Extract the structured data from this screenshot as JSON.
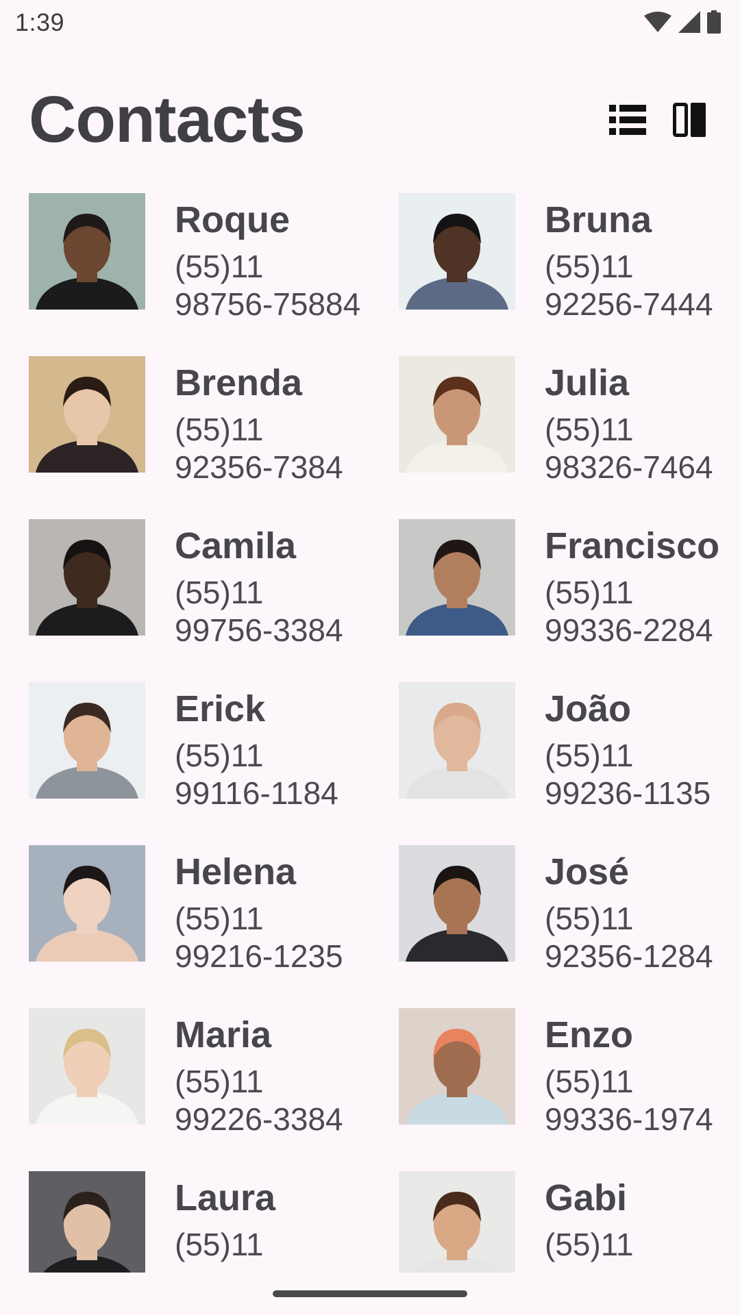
{
  "status": {
    "time": "1:39"
  },
  "header": {
    "title": "Contacts"
  },
  "icons": {
    "list_view": "list-view-icon",
    "grid_view": "two-column-view-icon"
  },
  "contacts": [
    {
      "name": "Roque",
      "phone_prefix": "(55)11",
      "phone_number": "98756-75884",
      "bg": "#9fb3ad",
      "skin": "#6b4630",
      "hair": "#1f1a17",
      "shirt": "#1b1b1d"
    },
    {
      "name": "Bruna",
      "phone_prefix": "(55)11",
      "phone_number": "92256-7444",
      "bg": "#e9eef0",
      "skin": "#4f3325",
      "hair": "#151213",
      "shirt": "#5c6a86"
    },
    {
      "name": "Brenda",
      "phone_prefix": "(55)11",
      "phone_number": "92356-7384",
      "bg": "#d4b88e",
      "skin": "#e7c6aa",
      "hair": "#2a1b14",
      "shirt": "#2c2424"
    },
    {
      "name": "Julia",
      "phone_prefix": "(55)11",
      "phone_number": "98326-7464",
      "bg": "#ece8e2",
      "skin": "#c99777",
      "hair": "#5d301c",
      "shirt": "#f3efe9"
    },
    {
      "name": "Camila",
      "phone_prefix": "(55)11",
      "phone_number": "99756-3384",
      "bg": "#b9b6b3",
      "skin": "#3f2a20",
      "hair": "#161212",
      "shirt": "#1c1c1e"
    },
    {
      "name": "Francisco",
      "phone_prefix": "(55)11",
      "phone_number": "99336-2284",
      "bg": "#c8c8c6",
      "skin": "#b27f5e",
      "hair": "#1f1714",
      "shirt": "#3e5a86"
    },
    {
      "name": "Erick",
      "phone_prefix": "(55)11",
      "phone_number": "99116-1184",
      "bg": "#eceff2",
      "skin": "#e0b596",
      "hair": "#3a2a21",
      "shirt": "#8d949c"
    },
    {
      "name": "João",
      "phone_prefix": "(55)11",
      "phone_number": "99236-1135",
      "bg": "#e8eaec",
      "skin": "#e1b89b",
      "hair": "#d8a98a",
      "shirt": "#e3e3e3"
    },
    {
      "name": "Helena",
      "phone_prefix": "(55)11",
      "phone_number": "99216-1235",
      "bg": "#a7b0bd",
      "skin": "#efd2bf",
      "hair": "#1d1616",
      "shirt": "#e9cbb8"
    },
    {
      "name": "José",
      "phone_prefix": "(55)11",
      "phone_number": "92356-1284",
      "bg": "#dadcdf",
      "skin": "#a97454",
      "hair": "#1a1412",
      "shirt": "#2a2a2e"
    },
    {
      "name": "Maria",
      "phone_prefix": "(55)11",
      "phone_number": "99226-3384",
      "bg": "#e7e8e6",
      "skin": "#efcfb7",
      "hair": "#d9c08a",
      "shirt": "#f5f5f3"
    },
    {
      "name": "Enzo",
      "phone_prefix": "(55)11",
      "phone_number": "99336-1974",
      "bg": "#ddd3cb",
      "skin": "#a06c4f",
      "hair": "#e7845f",
      "shirt": "#c9dbe2"
    },
    {
      "name": "Laura",
      "phone_prefix": "(55)11",
      "phone_number": "",
      "bg": "#5f5f63",
      "skin": "#e2c0a8",
      "hair": "#2b211c",
      "shirt": "#1d1d1f"
    },
    {
      "name": "Gabi",
      "phone_prefix": "(55)11",
      "phone_number": "",
      "bg": "#e9e9e7",
      "skin": "#d9a885",
      "hair": "#4a2a1a",
      "shirt": "#e6e6e6"
    }
  ]
}
